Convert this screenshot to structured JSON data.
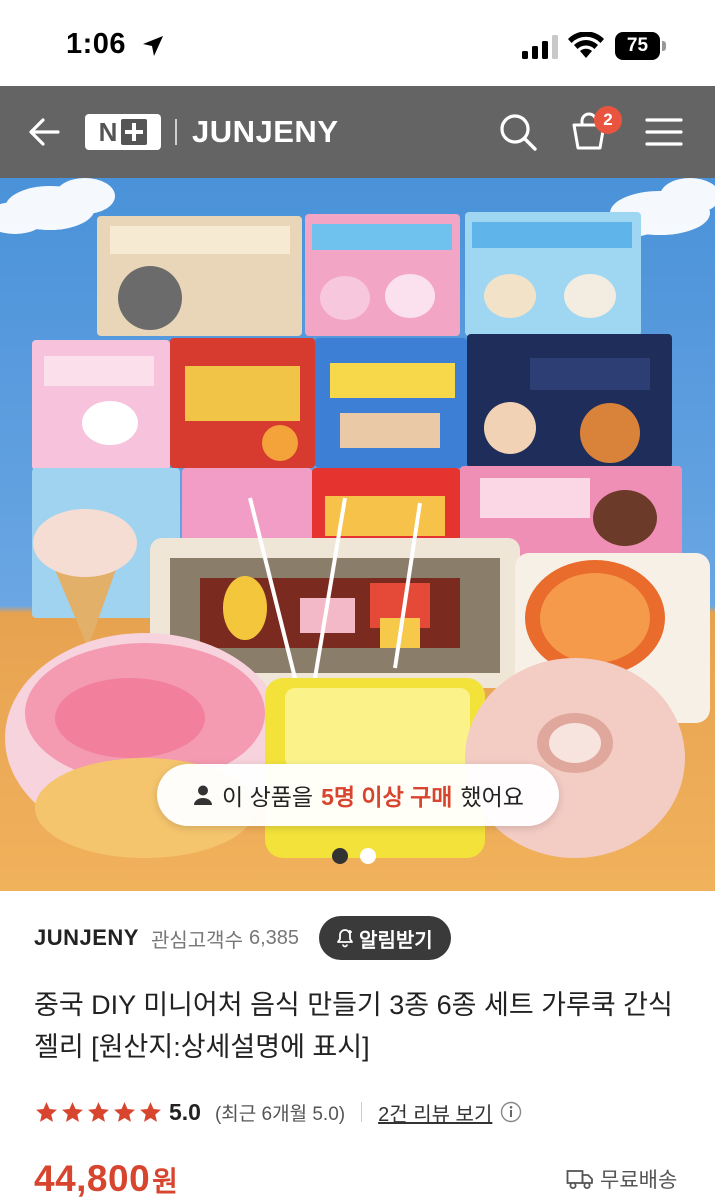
{
  "status_bar": {
    "time": "1:06",
    "battery": "75"
  },
  "header": {
    "badge_text": "N",
    "store_name": "JUNJENY",
    "cart_count": "2",
    "icons": [
      "back-arrow-icon",
      "search-icon",
      "cart-icon",
      "menu-icon"
    ]
  },
  "hero": {
    "buyers_prefix": "이 상품을",
    "buyers_highlight": "5명 이상 구매",
    "buyers_suffix": "했어요",
    "slide_count": 2,
    "active_slide": 1
  },
  "seller": {
    "name": "JUNJENY",
    "follower_label": "관심고객수",
    "follower_count": "6,385",
    "notify_label": "알림받기"
  },
  "product": {
    "title": "중국 DIY 미니어처 음식 만들기 3종 6종 세트 가루쿡 간식 젤리 [원산지:상세설명에 표시]",
    "rating_stars": 5,
    "rating": "5.0",
    "recent_rating": "(최근 6개월 5.0)",
    "review_link": "2건 리뷰 보기",
    "price": "44,800",
    "currency": "원",
    "shipping": "무료배송"
  },
  "colors": {
    "header_bg": "#646464",
    "accent_red": "#d8452f",
    "badge_red": "#e8543e",
    "star_red": "#d8452f"
  }
}
